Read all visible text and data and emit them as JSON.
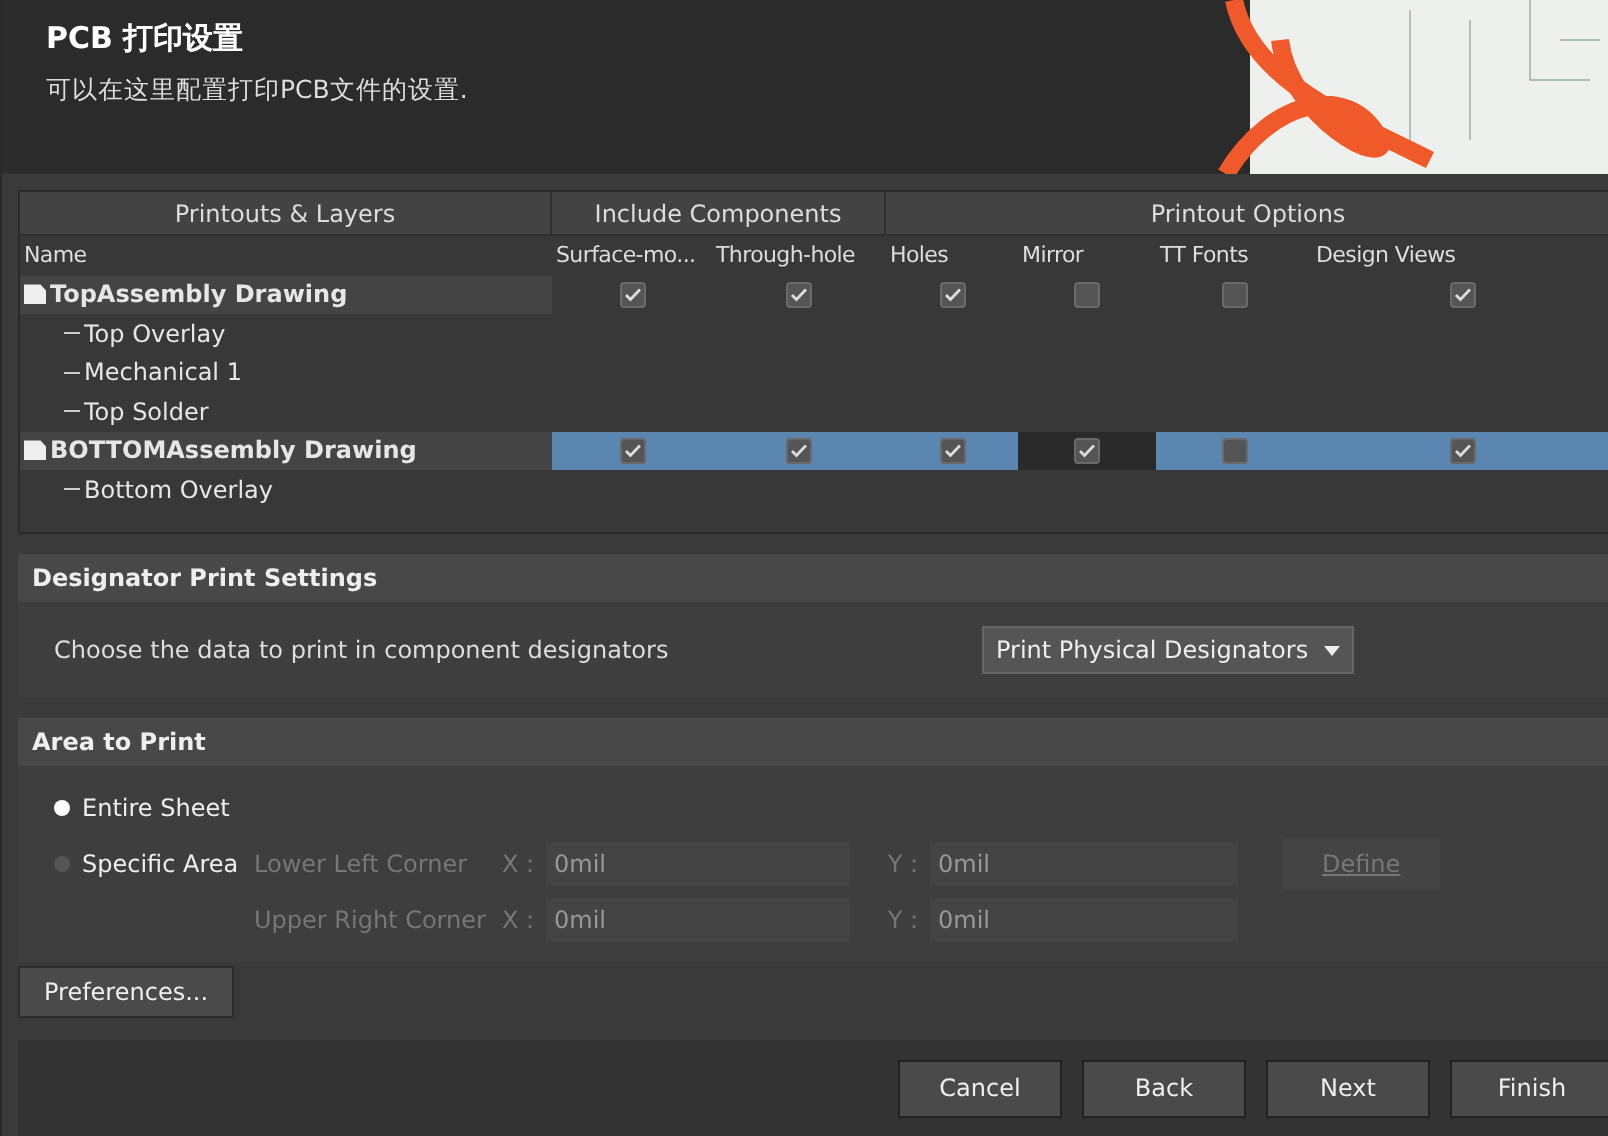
{
  "header": {
    "title": "PCB 打印设置",
    "subtitle": "可以在这里配置打印PCB文件的设置."
  },
  "table": {
    "groups": [
      {
        "label": "Printouts & Layers"
      },
      {
        "label": "Include Components"
      },
      {
        "label": "Printout Options"
      }
    ],
    "columns": [
      "Name",
      "Surface-mo...",
      "Through-hole",
      "Holes",
      "Mirror",
      "TT Fonts",
      "Design Views"
    ],
    "rows": [
      {
        "kind": "printout",
        "name": "TopAssembly Drawing",
        "selected": false,
        "checks": [
          true,
          true,
          true,
          false,
          false,
          true
        ]
      },
      {
        "kind": "layer",
        "name": "Top Overlay"
      },
      {
        "kind": "layer",
        "name": "Mechanical 1"
      },
      {
        "kind": "layer",
        "name": "Top Solder"
      },
      {
        "kind": "printout",
        "name": "BOTTOMAssembly Drawing",
        "selected": true,
        "checks": [
          true,
          true,
          true,
          true,
          false,
          true
        ]
      },
      {
        "kind": "layer",
        "name": "Bottom Overlay"
      }
    ]
  },
  "designator": {
    "title": "Designator Print Settings",
    "label": "Choose the data to print in component designators",
    "value": "Print Physical Designators"
  },
  "area": {
    "title": "Area to Print",
    "options": [
      {
        "label": "Entire Sheet",
        "selected": true
      },
      {
        "label": "Specific Area",
        "selected": false
      }
    ],
    "corners": [
      {
        "label": "Lower Left Corner",
        "x_label": "X :",
        "x": "0mil",
        "y_label": "Y :",
        "y": "0mil"
      },
      {
        "label": "Upper Right Corner",
        "x_label": "X :",
        "x": "0mil",
        "y_label": "Y :",
        "y": "0mil"
      }
    ],
    "define": "Define"
  },
  "preferences": "Preferences...",
  "buttons": [
    "Cancel",
    "Back",
    "Next",
    "Finish"
  ]
}
